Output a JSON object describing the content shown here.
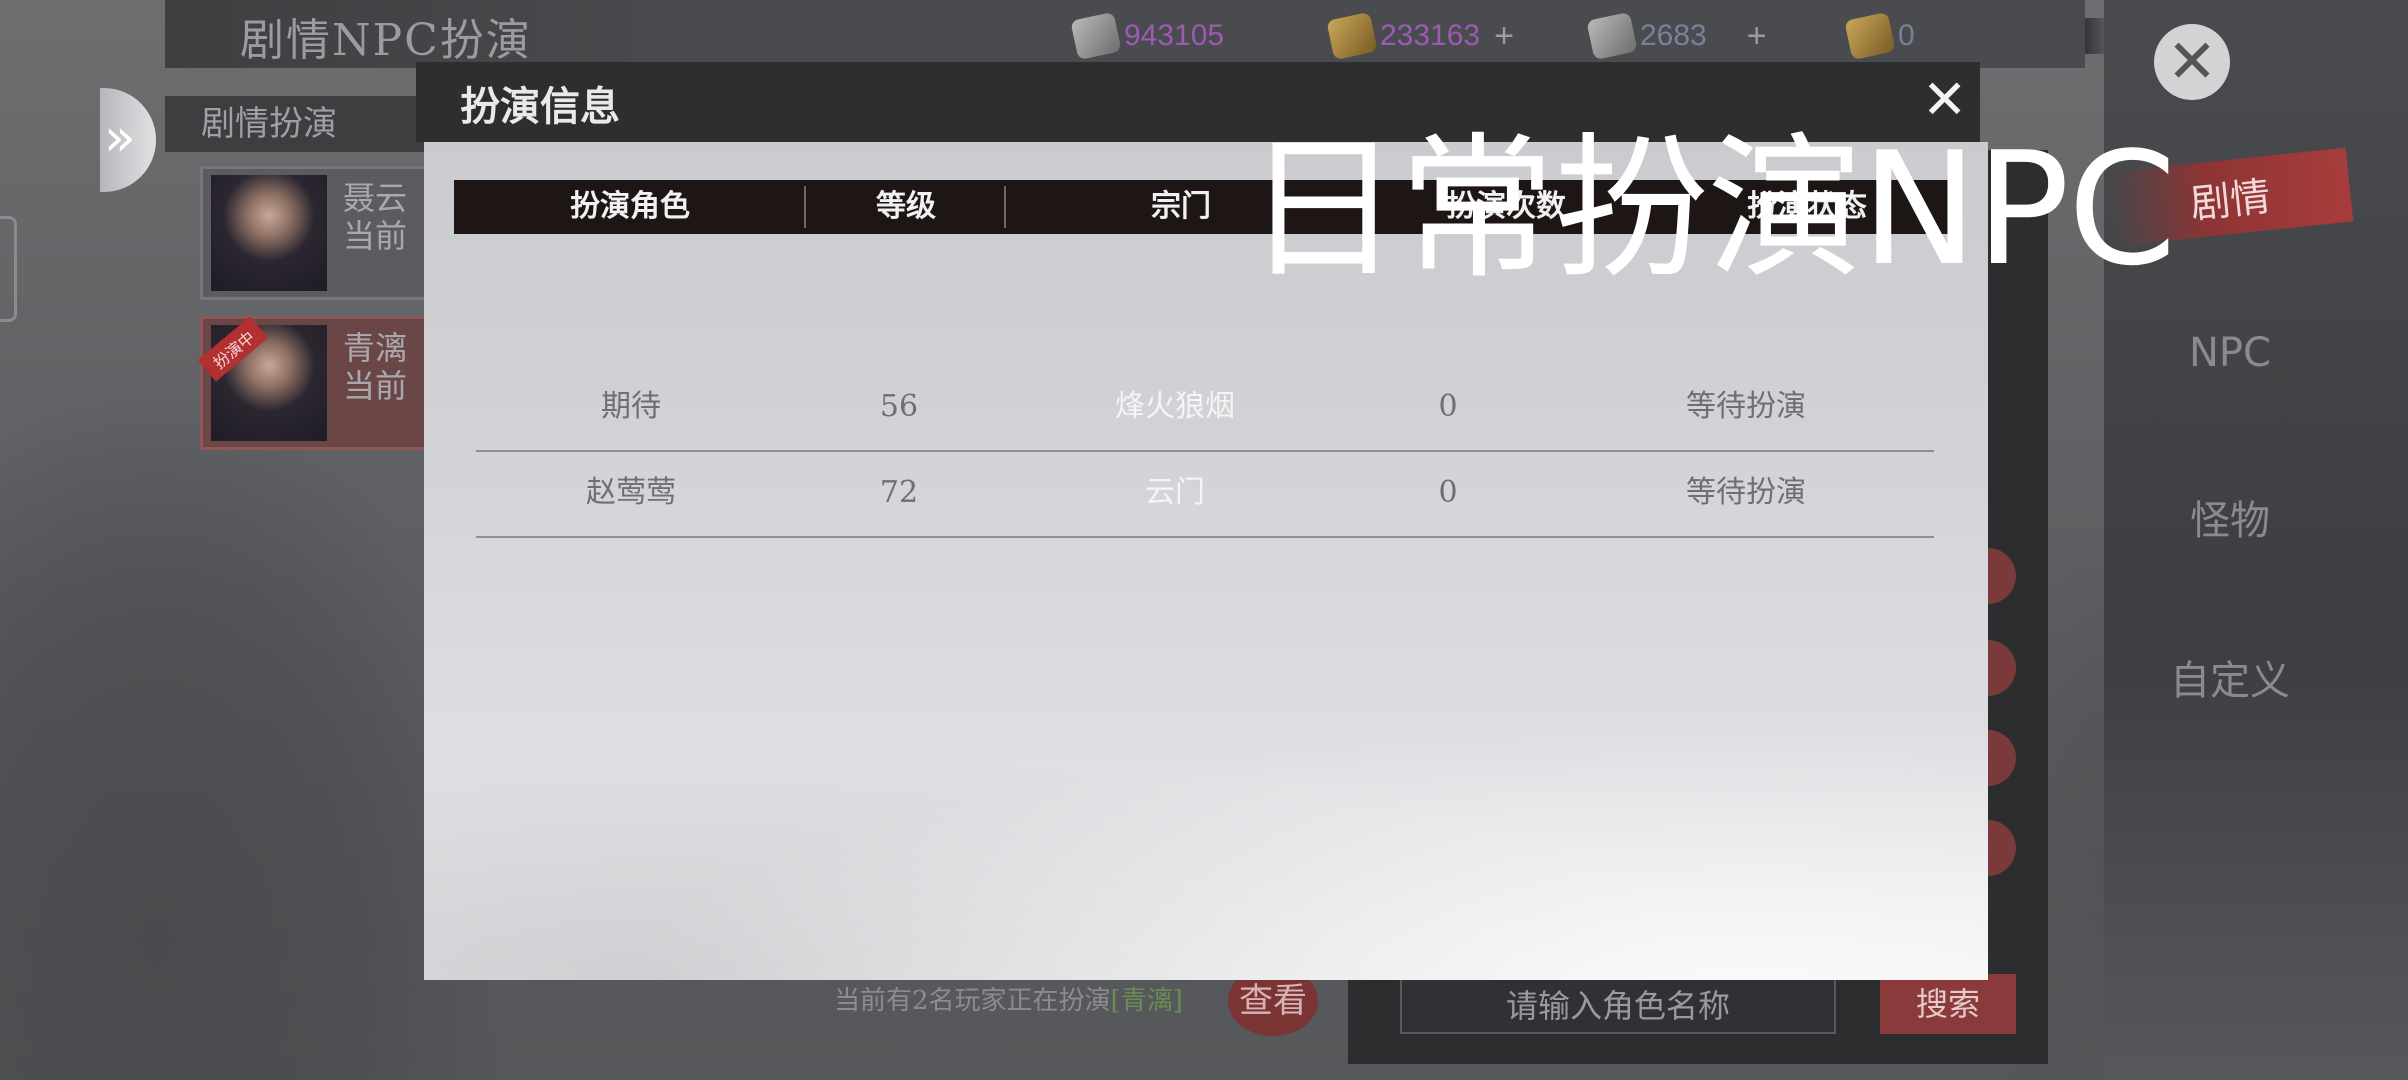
{
  "app": {
    "title": "剧情NPC扮演"
  },
  "currencies": [
    {
      "icon": "token-icon",
      "value": "943105",
      "color": "#9c5bb3",
      "plus": ""
    },
    {
      "icon": "gold-ingot-icon",
      "value": "233163",
      "color": "#9c5bb3",
      "plus": "+"
    },
    {
      "icon": "silver-icon",
      "value": "2683",
      "color": "#7a7f9c",
      "plus": "+"
    },
    {
      "icon": "coin-icon",
      "value": "0",
      "color": "#7a7f9c",
      "plus": ""
    }
  ],
  "sub_tab": {
    "label": "剧情扮演"
  },
  "npc_list": [
    {
      "name": "聂云",
      "status": "当前",
      "active": false
    },
    {
      "name": "青漓",
      "status": "当前",
      "active": true,
      "badge": "扮演中"
    }
  ],
  "rail": {
    "tabs": [
      {
        "label": "剧情",
        "active": true
      },
      {
        "label": "NPC",
        "active": false
      },
      {
        "label": "怪物",
        "active": false
      },
      {
        "label": "自定义",
        "active": false
      }
    ]
  },
  "footer": {
    "status_prefix": "当前有2名玩家正在扮演",
    "status_highlight": "[青漓]",
    "view_label": "查看"
  },
  "search": {
    "placeholder": "请输入角色名称",
    "button_label": "搜索"
  },
  "modal": {
    "title": "扮演信息",
    "close_glyph": "✕",
    "columns": [
      "扮演角色",
      "等级",
      "宗门",
      "扮演次数",
      "扮演状态"
    ],
    "rows": [
      {
        "role": "期待",
        "level": "56",
        "sect": "烽火狼烟",
        "count": "0",
        "status": "等待扮演"
      },
      {
        "role": "赵莺莺",
        "level": "72",
        "sect": "云门",
        "count": "0",
        "status": "等待扮演"
      }
    ]
  },
  "overlay_caption": "日常扮演NPC"
}
